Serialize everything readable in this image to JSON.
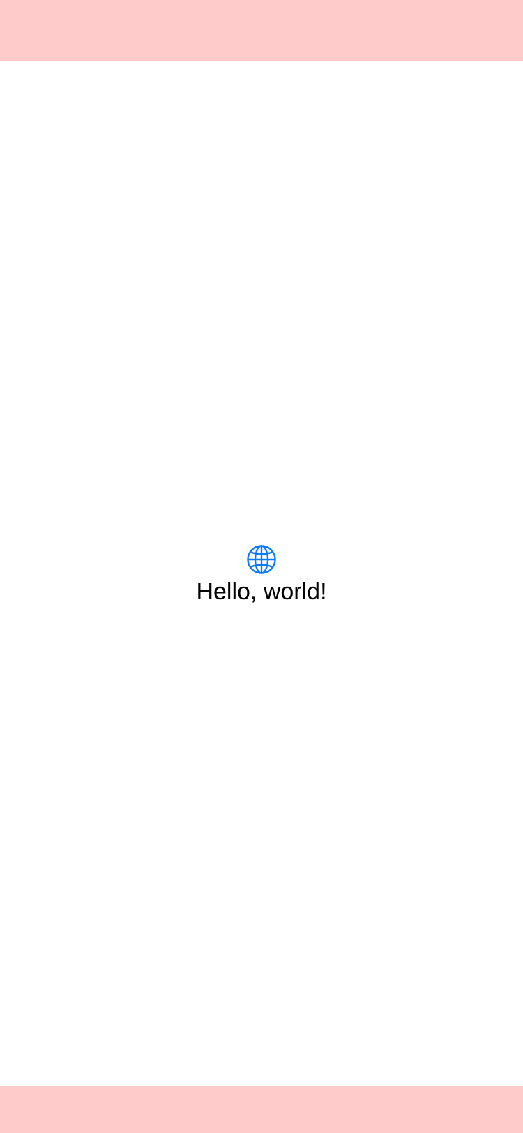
{
  "colors": {
    "safe_area_bar": "#FFCACA",
    "background": "#FFFFFF",
    "accent": "#0A7AFF",
    "text": "#000000"
  },
  "content": {
    "icon": "globe-icon",
    "greeting": "Hello, world!"
  }
}
